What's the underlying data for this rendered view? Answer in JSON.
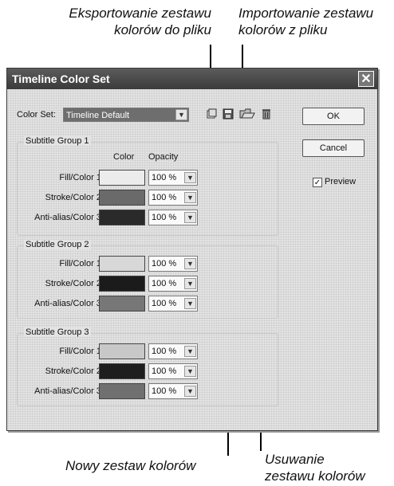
{
  "callouts": {
    "export": [
      "Eksportowanie zestawu",
      "kolorów do pliku"
    ],
    "import": [
      "Importowanie zestawu",
      "kolorów z pliku"
    ],
    "new": "Nowy zestaw kolorów",
    "delete": [
      "Usuwanie",
      "zestawu kolorów"
    ]
  },
  "dialog": {
    "title": "Timeline Color Set",
    "close_glyph": "✕",
    "color_set_label": "Color Set:",
    "color_set_value": "Timeline Default",
    "ok_label": "OK",
    "cancel_label": "Cancel",
    "preview_label": "Preview",
    "preview_checked": true,
    "col_color": "Color",
    "col_opacity": "Opacity",
    "groups": [
      {
        "title": "Subtitle Group 1",
        "rows": [
          {
            "label": "Fill/Color 1:",
            "color": "#ececec",
            "opacity": "100 %"
          },
          {
            "label": "Stroke/Color 2:",
            "color": "#6a6a6a",
            "opacity": "100 %"
          },
          {
            "label": "Anti-alias/Color 3:",
            "color": "#2a2a2a",
            "opacity": "100 %"
          }
        ]
      },
      {
        "title": "Subtitle Group 2",
        "rows": [
          {
            "label": "Fill/Color 1:",
            "color": "#d8d8d8",
            "opacity": "100 %"
          },
          {
            "label": "Stroke/Color 2:",
            "color": "#1b1b1b",
            "opacity": "100 %"
          },
          {
            "label": "Anti-alias/Color 3:",
            "color": "#777777",
            "opacity": "100 %"
          }
        ]
      },
      {
        "title": "Subtitle Group 3",
        "rows": [
          {
            "label": "Fill/Color 1:",
            "color": "#c8c8c8",
            "opacity": "100 %"
          },
          {
            "label": "Stroke/Color 2:",
            "color": "#1e1e1e",
            "opacity": "100 %"
          },
          {
            "label": "Anti-alias/Color 3:",
            "color": "#707070",
            "opacity": "100 %"
          }
        ]
      }
    ]
  },
  "icons": {
    "new_set": "new-set-icon",
    "save_set": "save-icon",
    "import_set": "import-icon",
    "delete_set": "delete-icon"
  }
}
